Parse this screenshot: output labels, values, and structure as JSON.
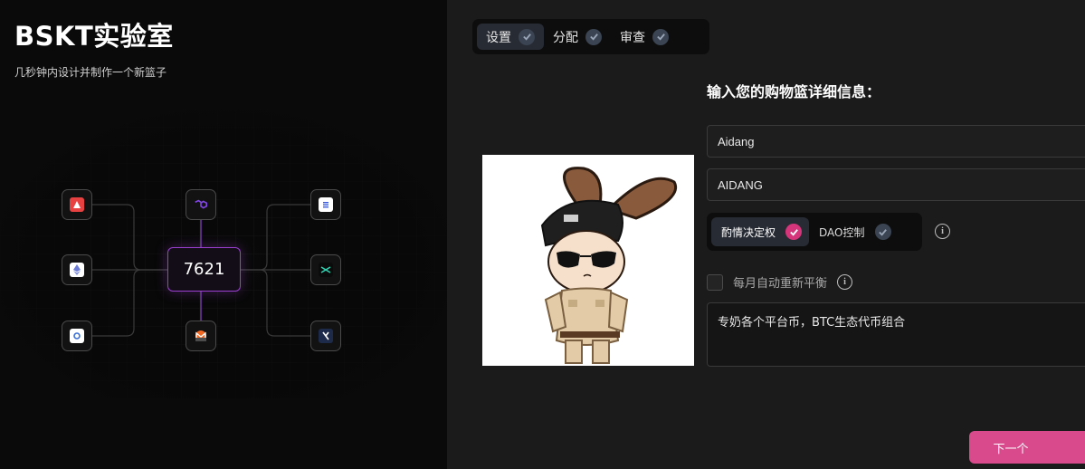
{
  "brand": {
    "title": "BSKT实验室",
    "subtitle": "几秒钟内设计并制作一个新篮子"
  },
  "diagram": {
    "center_value": "7621",
    "tiles": [
      {
        "name": "avalanche-icon",
        "color": "#e84142"
      },
      {
        "name": "polygon-icon",
        "color": "#8247e5"
      },
      {
        "name": "solana-icon",
        "color": "#ffffff"
      },
      {
        "name": "ethereum-icon",
        "color": "#ffffff"
      },
      {
        "name": "dymension-icon",
        "color": "#0b0b0b"
      },
      {
        "name": "sui-icon",
        "color": "#ffffff"
      },
      {
        "name": "monero-icon",
        "color": "#f26822"
      },
      {
        "name": "xchain-icon",
        "color": "#1e2a4a"
      }
    ]
  },
  "steps": [
    {
      "label": "设置",
      "active": true
    },
    {
      "label": "分配",
      "active": false
    },
    {
      "label": "审查",
      "active": false
    }
  ],
  "form": {
    "title": "输入您的购物篮详细信息：",
    "name_value": "Aidang",
    "symbol_value": "AIDANG",
    "governance_options": [
      "酌情决定权",
      "DAO控制"
    ],
    "rebalance_label": "每月自动重新平衡",
    "description_value": "专奶各个平台币，BTC生态代币组合"
  },
  "actions": {
    "next_label": "下一个"
  },
  "colors": {
    "accent_pink": "#d94a8c",
    "check_pink": "#d4357b",
    "check_gray": "#3a4452",
    "grid_purple": "#7a3fb0"
  }
}
